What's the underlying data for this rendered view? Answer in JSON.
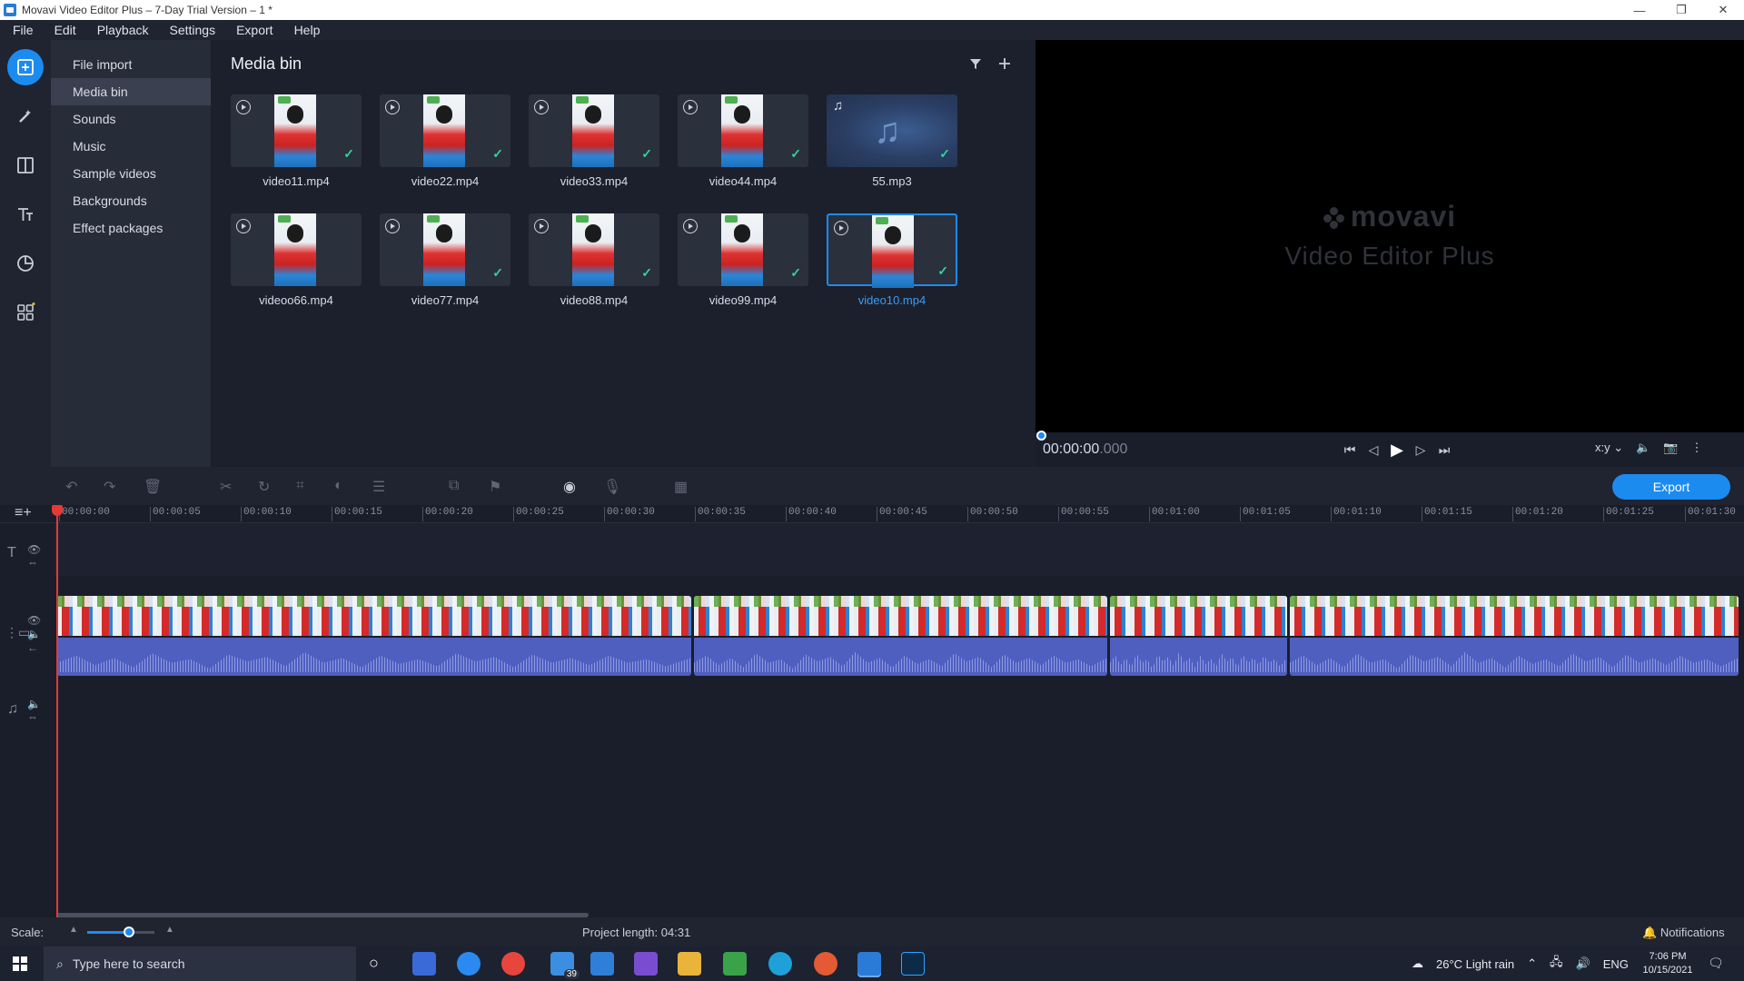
{
  "window": {
    "title": "Movavi Video Editor Plus – 7-Day Trial Version – 1 *",
    "minimize": "—",
    "restore": "❐",
    "close": "✕"
  },
  "menu": [
    "File",
    "Edit",
    "Playback",
    "Settings",
    "Export",
    "Help"
  ],
  "rail": {
    "items": [
      "import-icon",
      "magic-wand-icon",
      "transitions-icon",
      "titles-icon",
      "stickers-icon",
      "more-tools-icon"
    ],
    "active_index": 0
  },
  "categories": {
    "items": [
      "File import",
      "Media bin",
      "Sounds",
      "Music",
      "Sample videos",
      "Backgrounds",
      "Effect packages"
    ],
    "active_index": 1
  },
  "media_bin": {
    "title": "Media bin",
    "items": [
      {
        "name": "video11.mp4",
        "type": "video"
      },
      {
        "name": "video22.mp4",
        "type": "video"
      },
      {
        "name": "video33.mp4",
        "type": "video"
      },
      {
        "name": "video44.mp4",
        "type": "video"
      },
      {
        "name": "55.mp3",
        "type": "audio"
      },
      {
        "name": "videoo66.mp4",
        "type": "video"
      },
      {
        "name": "video77.mp4",
        "type": "video"
      },
      {
        "name": "video88.mp4",
        "type": "video"
      },
      {
        "name": "video99.mp4",
        "type": "video"
      },
      {
        "name": "video10.mp4",
        "type": "video",
        "selected": true
      }
    ]
  },
  "preview": {
    "logo": "movavi",
    "subtitle": "Video Editor Plus",
    "time_main": "00:00:00",
    "time_ms": ".000",
    "aspect": "x:y"
  },
  "timeline": {
    "export_label": "Export",
    "ticks": [
      "00:00:00",
      "00:00:05",
      "00:00:10",
      "00:00:15",
      "00:00:20",
      "00:00:25",
      "00:00:30",
      "00:00:35",
      "00:00:40",
      "00:00:45",
      "00:00:50",
      "00:00:55",
      "00:01:00",
      "00:01:05",
      "00:01:10",
      "00:01:15",
      "00:01:20",
      "00:01:25",
      "00:01:30"
    ]
  },
  "status": {
    "scale_label": "Scale:",
    "project_length": "Project length:  04:31",
    "notifications": "Notifications"
  },
  "taskbar": {
    "search_placeholder": "Type here to search",
    "badge": "39",
    "weather": "26°C  Light rain",
    "lang": "ENG",
    "time": "7:06 PM",
    "date": "10/15/2021"
  },
  "colors": {
    "accent": "#1c8bf0",
    "playhead": "#e53935",
    "check": "#34d399"
  }
}
